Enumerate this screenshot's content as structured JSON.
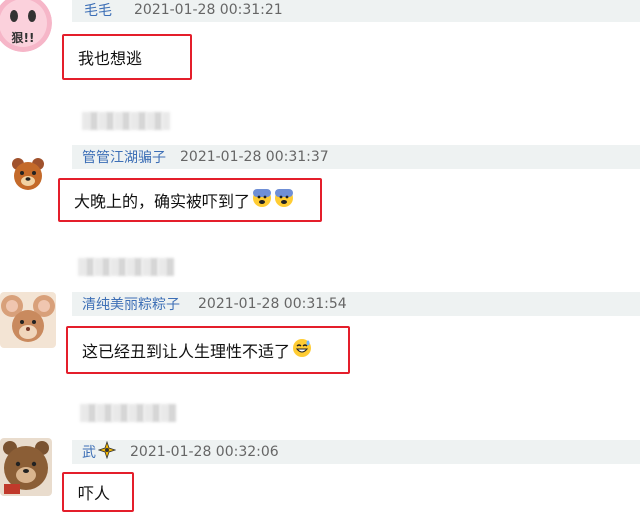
{
  "comments": [
    {
      "username": "毛毛",
      "timestamp": "2021-01-28 00:31:21",
      "text": "我也想逃",
      "avatar": "pink-cartoon-avatar"
    },
    {
      "username": "管管江湖骗子",
      "timestamp": "2021-01-28 00:31:37",
      "text": "大晚上的，确实被吓到了",
      "emojis": [
        "fearful-face",
        "fearful-face"
      ],
      "avatar": "bear-avatar"
    },
    {
      "username": "清纯美丽粽粽子",
      "timestamp": "2021-01-28 00:31:54",
      "text": "这已经丑到让人生理性不适了",
      "emojis": [
        "grinning-sweat-face"
      ],
      "avatar": "mouse-avatar"
    },
    {
      "username": "武",
      "timestamp": "2021-01-28 00:32:06",
      "text": "吓人",
      "badge": "sparkle-badge",
      "avatar": "brown-bear-avatar"
    }
  ],
  "colors": {
    "username": "#3d6fb6",
    "highlight_border": "#e41e2b",
    "header_bg": "#eef2f2"
  }
}
